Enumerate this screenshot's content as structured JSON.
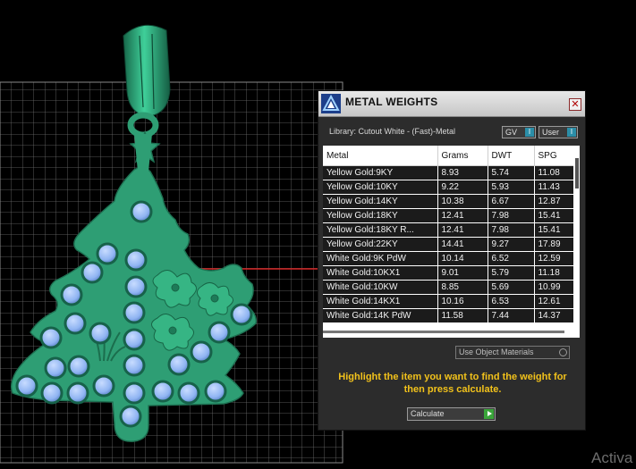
{
  "panel": {
    "title": "METAL WEIGHTS",
    "library_label": "Library: Cutout White - (Fast)-Metal",
    "toggles": {
      "gv": "GV",
      "user": "User",
      "on_glyph": "I"
    },
    "close_glyph": "✕",
    "table": {
      "columns": [
        "Metal",
        "Grams",
        "DWT",
        "SPG"
      ],
      "rows": [
        [
          "Yellow Gold:9KY",
          "8.93",
          "5.74",
          "11.08"
        ],
        [
          "Yellow Gold:10KY",
          "9.22",
          "5.93",
          "11.43"
        ],
        [
          "Yellow Gold:14KY",
          "10.38",
          "6.67",
          "12.87"
        ],
        [
          "Yellow Gold:18KY",
          "12.41",
          "7.98",
          "15.41"
        ],
        [
          "Yellow Gold:18KY R...",
          "12.41",
          "7.98",
          "15.41"
        ],
        [
          "Yellow Gold:22KY",
          "14.41",
          "9.27",
          "17.89"
        ],
        [
          "White Gold:9K PdW",
          "10.14",
          "6.52",
          "12.59"
        ],
        [
          "White Gold:10KX1",
          "9.01",
          "5.79",
          "11.18"
        ],
        [
          "White Gold:10KW",
          "8.85",
          "5.69",
          "10.99"
        ],
        [
          "White Gold:14KX1",
          "10.16",
          "6.53",
          "12.61"
        ],
        [
          "White Gold:14K PdW",
          "11.58",
          "7.44",
          "14.37"
        ]
      ]
    },
    "use_object_materials": "Use Object Materials",
    "instructions": "Highlight the item you want to find the weight for then press calculate.",
    "calculate_label": "Calculate"
  },
  "watermark": "Activa",
  "colors": {
    "pendant": "#2e9e74",
    "gem": "#8fb4f2",
    "accent_text": "#f2c21b",
    "grid": "#6e6e6e"
  }
}
